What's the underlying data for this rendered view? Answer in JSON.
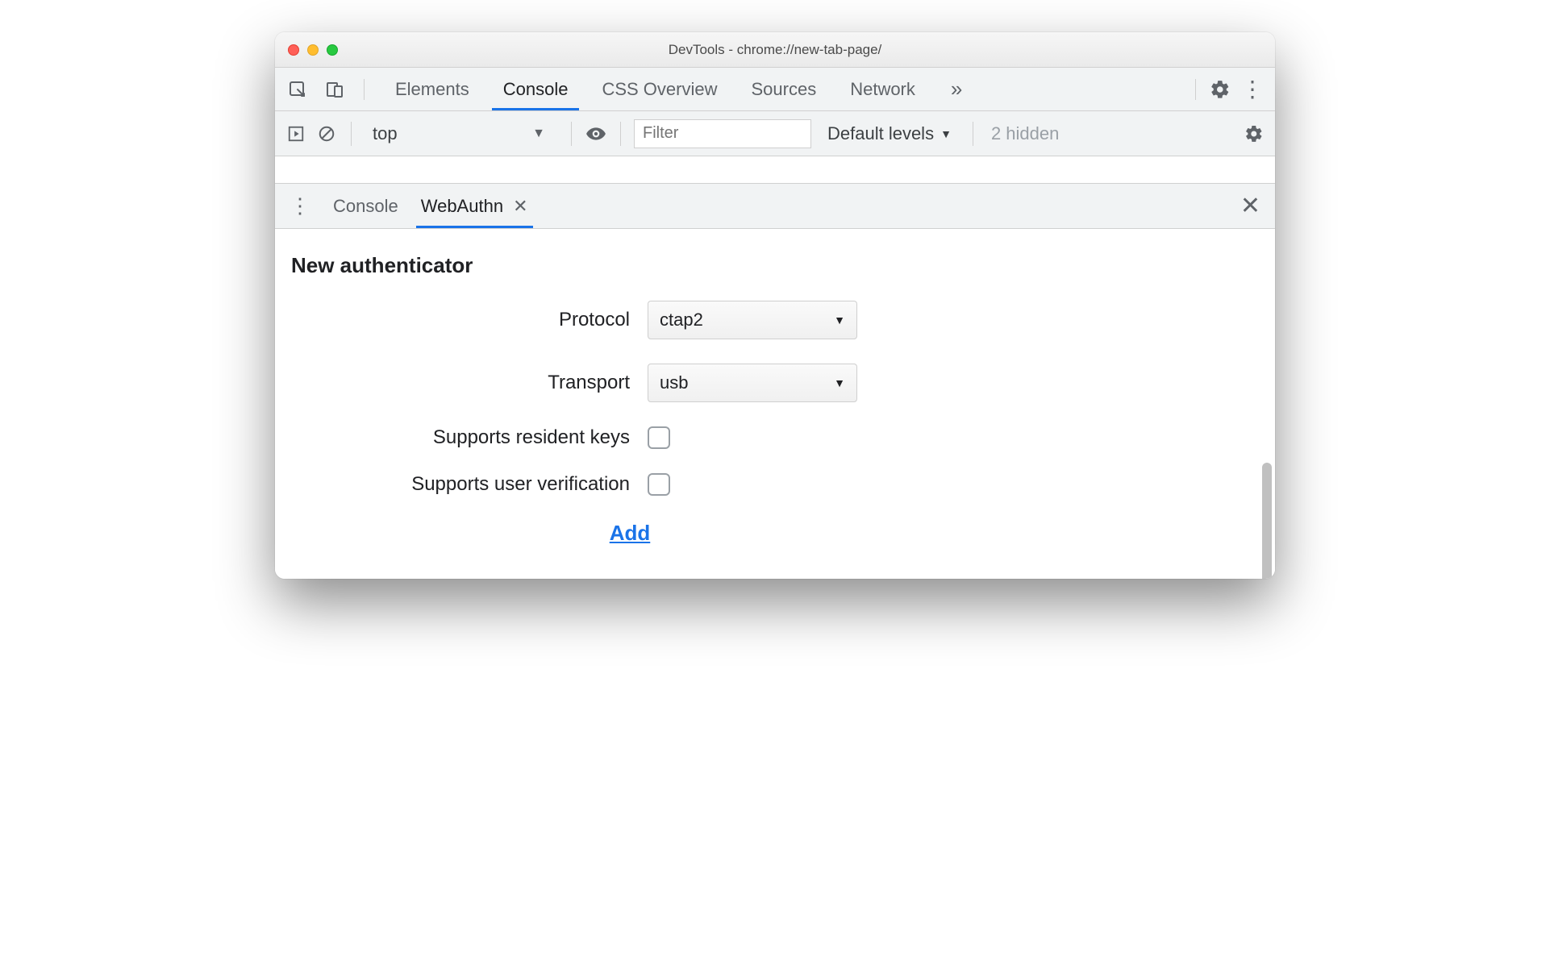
{
  "window": {
    "title": "DevTools - chrome://new-tab-page/"
  },
  "topTabs": {
    "items": [
      "Elements",
      "Console",
      "CSS Overview",
      "Sources",
      "Network"
    ],
    "activeIndex": 1
  },
  "consoleToolbar": {
    "context": "top",
    "filterPlaceholder": "Filter",
    "levels": "Default levels",
    "hidden": "2 hidden"
  },
  "drawer": {
    "tabs": [
      {
        "label": "Console",
        "closable": false
      },
      {
        "label": "WebAuthn",
        "closable": true
      }
    ],
    "activeIndex": 1
  },
  "webauthn": {
    "heading": "New authenticator",
    "protocolLabel": "Protocol",
    "protocolValue": "ctap2",
    "transportLabel": "Transport",
    "transportValue": "usb",
    "residentKeysLabel": "Supports resident keys",
    "residentKeysChecked": false,
    "userVerificationLabel": "Supports user verification",
    "userVerificationChecked": false,
    "addLabel": "Add"
  }
}
